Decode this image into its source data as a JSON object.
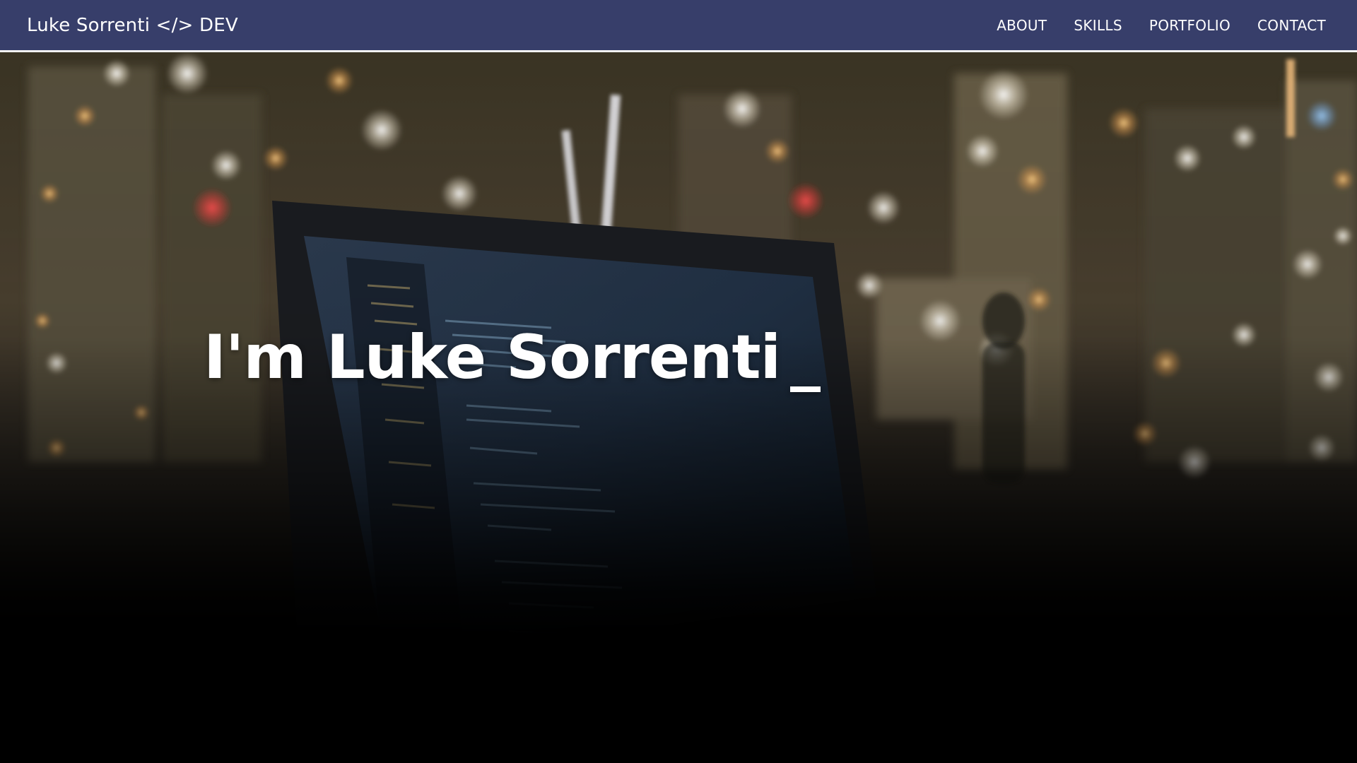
{
  "navbar": {
    "brand": "Luke Sorrenti </> DEV",
    "links": [
      {
        "label": "ABOUT"
      },
      {
        "label": "SKILLS"
      },
      {
        "label": "PORTFOLIO"
      },
      {
        "label": "CONTACT"
      }
    ]
  },
  "hero": {
    "title": "I'm Luke Sorrenti",
    "cursor": "_"
  },
  "colors": {
    "navbar_bg": "#373e6a",
    "navbar_border": "#f2f2f2",
    "text": "#ffffff",
    "page_bg": "#000000"
  },
  "icons": {
    "background": "night-city-laptop-code-photo"
  }
}
